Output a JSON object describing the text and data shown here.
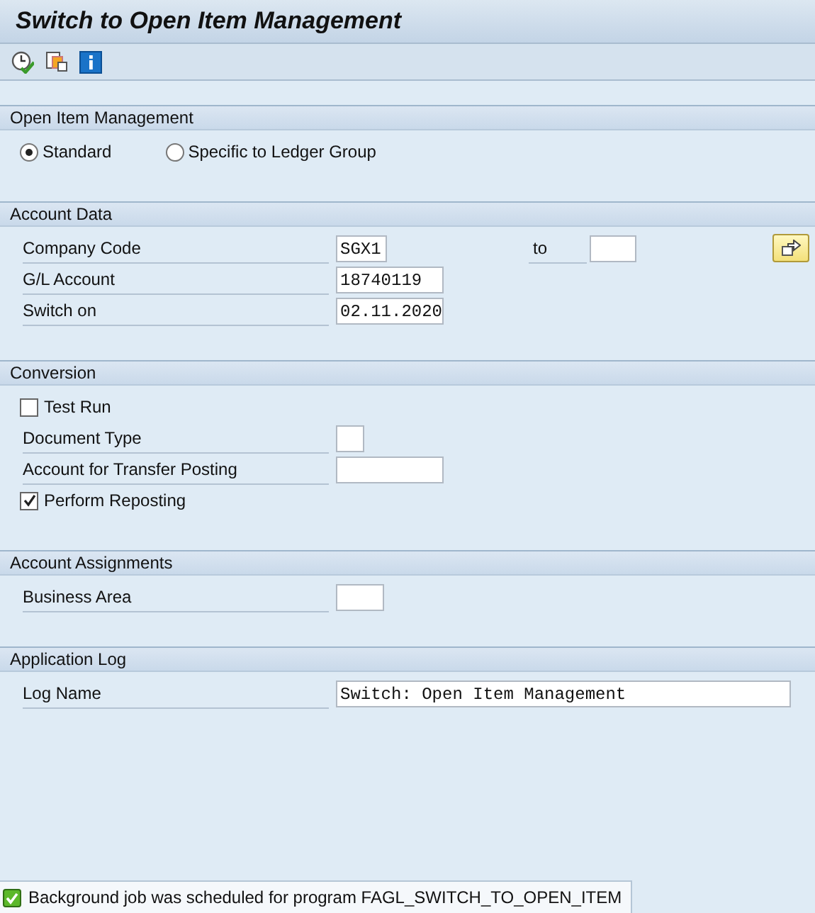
{
  "window": {
    "title": "Switch to Open Item Management"
  },
  "toolbar": [
    {
      "kind": "execute"
    },
    {
      "kind": "variants"
    },
    {
      "kind": "info"
    }
  ],
  "sections": [
    {
      "title": "Open Item Management",
      "rows": [
        {
          "kind": "radios",
          "options": [
            {
              "label": "Standard",
              "selected": true
            },
            {
              "label": "Specific to Ledger Group",
              "selected": false
            }
          ]
        }
      ]
    },
    {
      "title": "Account Data",
      "rows": [
        {
          "kind": "range",
          "label": "Company Code",
          "value": "SGX1",
          "to_label": "to"
        },
        {
          "kind": "field",
          "label": "G/L Account",
          "value": "18740119"
        },
        {
          "kind": "field",
          "label": "Switch on",
          "value": "02.11.2020"
        }
      ]
    },
    {
      "title": "Conversion",
      "rows": [
        {
          "kind": "checkbox",
          "label": "Test Run",
          "checked": false
        },
        {
          "kind": "field",
          "label": "Document Type"
        },
        {
          "kind": "field",
          "label": "Account for Transfer Posting"
        },
        {
          "kind": "checkbox",
          "label": "Perform Reposting",
          "checked": true
        }
      ]
    },
    {
      "title": "Account Assignments",
      "rows": [
        {
          "kind": "field",
          "label": "Business Area"
        }
      ]
    },
    {
      "title": "Application Log",
      "rows": [
        {
          "kind": "field",
          "label": "Log Name",
          "value": "Switch: Open Item Management"
        }
      ]
    }
  ],
  "status_bar": {
    "kind": "success",
    "message": "Background job was scheduled for program FAGL_SWITCH_TO_OPEN_ITEM"
  }
}
